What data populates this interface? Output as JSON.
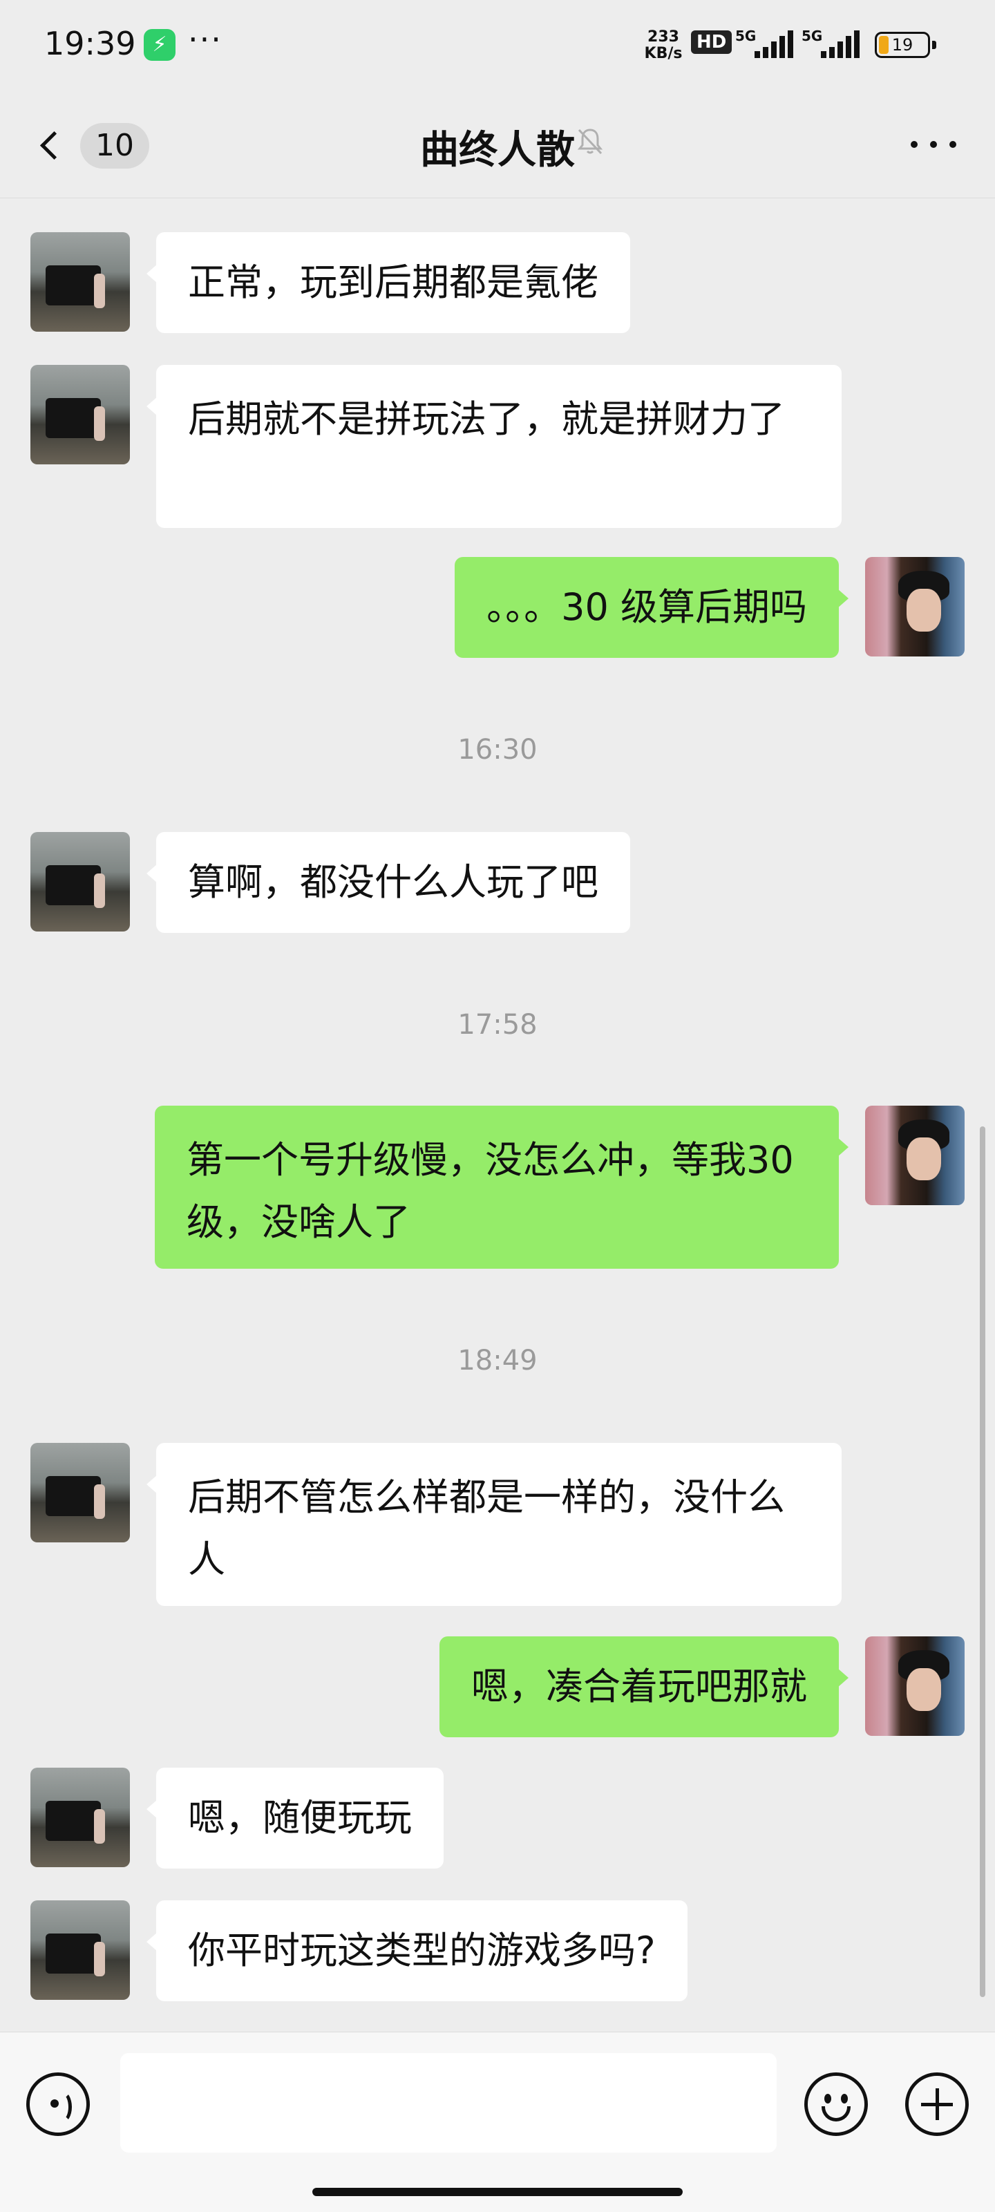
{
  "status_bar": {
    "time": "19:39",
    "app_icon": "charging-app-icon",
    "network_speed": "233",
    "network_unit": "KB/s",
    "hd": "HD",
    "signal_1": "5G",
    "signal_2": "5G",
    "battery_level": "19"
  },
  "nav": {
    "back_icon": "chevron-left-icon",
    "unread_count": "10",
    "title": "曲终人散",
    "mute_icon": "bell-muted-icon",
    "more_icon": "more-icon"
  },
  "messages": [
    {
      "sender": "other",
      "text": "正常，玩到后期都是氪佬"
    },
    {
      "sender": "other",
      "text": "后期就不是拼玩法了，就是拼财力了"
    },
    {
      "sender": "self",
      "text": "。。。30 级算后期吗"
    },
    {
      "type": "time",
      "text": "16:30"
    },
    {
      "sender": "other",
      "text": "算啊，都没什么人玩了吧"
    },
    {
      "type": "time",
      "text": "17:58"
    },
    {
      "sender": "self",
      "text": "第一个号升级慢，没怎么冲，等我30 级，没啥人了"
    },
    {
      "type": "time",
      "text": "18:49"
    },
    {
      "sender": "other",
      "text": "后期不管怎么样都是一样的，没什么人"
    },
    {
      "sender": "self",
      "text": "嗯，凑合着玩吧那就"
    },
    {
      "sender": "other",
      "text": "嗯，随便玩玩"
    },
    {
      "sender": "other",
      "text": "你平时玩这类型的游戏多吗?"
    }
  ],
  "input_bar": {
    "voice_icon": "voice-icon",
    "input_value": "",
    "emoji_icon": "emoji-icon",
    "plus_icon": "plus-icon"
  },
  "colors": {
    "background": "#ededed",
    "self_bubble": "#95ec69",
    "other_bubble": "#ffffff"
  }
}
